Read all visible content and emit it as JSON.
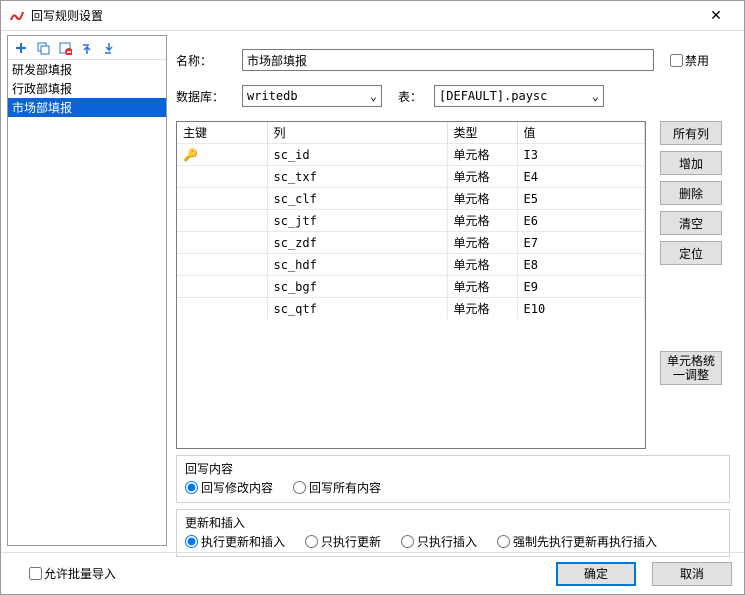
{
  "window": {
    "title": "回写规则设置"
  },
  "rules": {
    "items": [
      "研发部填报",
      "行政部填报",
      "市场部填报"
    ],
    "selected_index": 2
  },
  "form": {
    "name_label": "名称：",
    "name_value": "市场部填报",
    "disable_label": "禁用",
    "db_label": "数据库：",
    "db_value": "writedb",
    "table_label": "表：",
    "table_value": "[DEFAULT].paysc"
  },
  "grid": {
    "headers": {
      "pk": "主键",
      "col": "列",
      "type": "类型",
      "value": "值"
    },
    "rows": [
      {
        "pk": true,
        "col": "sc_id",
        "type": "单元格",
        "value": "I3"
      },
      {
        "pk": false,
        "col": "sc_txf",
        "type": "单元格",
        "value": "E4"
      },
      {
        "pk": false,
        "col": "sc_clf",
        "type": "单元格",
        "value": "E5"
      },
      {
        "pk": false,
        "col": "sc_jtf",
        "type": "单元格",
        "value": "E6"
      },
      {
        "pk": false,
        "col": "sc_zdf",
        "type": "单元格",
        "value": "E7"
      },
      {
        "pk": false,
        "col": "sc_hdf",
        "type": "单元格",
        "value": "E8"
      },
      {
        "pk": false,
        "col": "sc_bgf",
        "type": "单元格",
        "value": "E9"
      },
      {
        "pk": false,
        "col": "sc_qtf",
        "type": "单元格",
        "value": "E10"
      }
    ]
  },
  "sidebtns": {
    "all_cols": "所有列",
    "add": "增加",
    "delete": "删除",
    "clear": "清空",
    "locate": "定位",
    "adjust": "单元格统一调整"
  },
  "writeback": {
    "legend": "回写内容",
    "modify": "回写修改内容",
    "all": "回写所有内容"
  },
  "update": {
    "legend": "更新和插入",
    "both": "执行更新和插入",
    "update_only": "只执行更新",
    "insert_only": "只执行插入",
    "force": "强制先执行更新再执行插入"
  },
  "footer": {
    "batch_import": "允许批量导入",
    "ok": "确定",
    "cancel": "取消"
  }
}
